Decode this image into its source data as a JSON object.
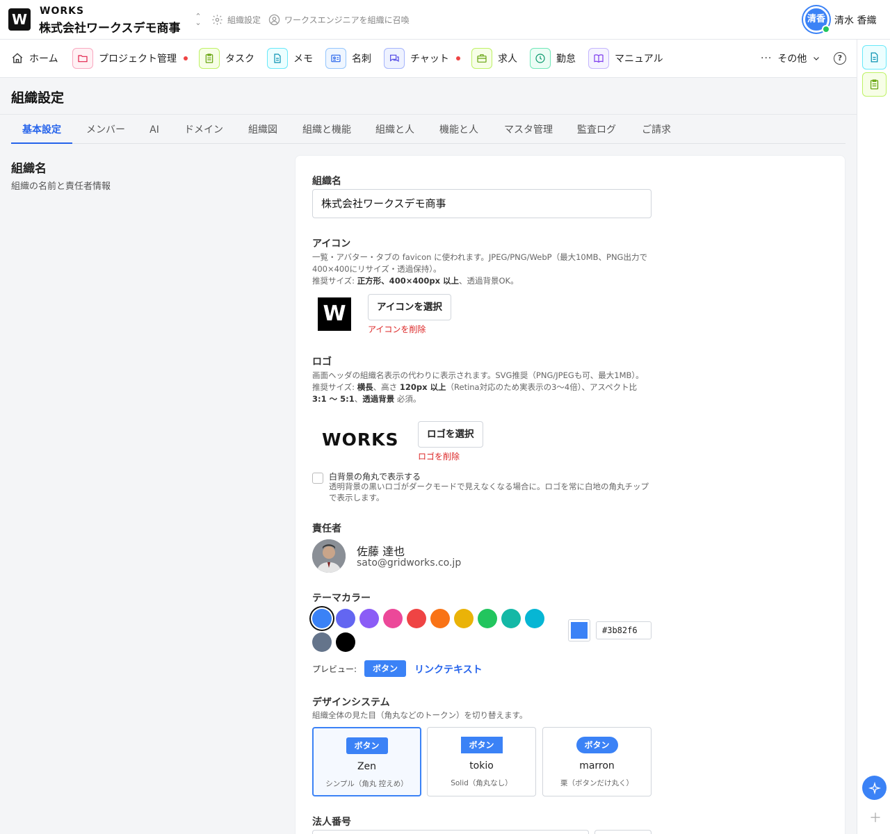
{
  "header": {
    "org_logo_letter": "W",
    "brand": "WORKS",
    "org_name": "株式会社ワークスデモ商事",
    "settings_link": "組織設定",
    "invite_link": "ワークスエンジニアを組織に召喚",
    "user_avatar": "清香",
    "user_name": "清水 香織"
  },
  "nav": {
    "items": [
      {
        "label": "ホーム",
        "icon": "home-icon"
      },
      {
        "label": "プロジェクト管理",
        "icon": "folder-icon",
        "color": "#e11d48",
        "dot": true
      },
      {
        "label": "タスク",
        "icon": "clipboard-icon",
        "color": "#65a30d"
      },
      {
        "label": "メモ",
        "icon": "document-icon",
        "color": "#0891b2"
      },
      {
        "label": "名刺",
        "icon": "card-icon",
        "color": "#2563eb"
      },
      {
        "label": "チャット",
        "icon": "chat-icon",
        "color": "#4f46e5",
        "dot": true
      },
      {
        "label": "求人",
        "icon": "briefcase-icon",
        "color": "#65a30d"
      },
      {
        "label": "勤怠",
        "icon": "clock-icon",
        "color": "#059669"
      },
      {
        "label": "マニュアル",
        "icon": "book-icon",
        "color": "#7c3aed"
      }
    ],
    "more_label": "その他"
  },
  "page": {
    "title": "組織設定",
    "tabs": [
      "基本設定",
      "メンバー",
      "AI",
      "ドメイン",
      "組織図",
      "組織と機能",
      "組織と人",
      "機能と人",
      "マスタ管理",
      "監査ログ",
      "ご請求"
    ],
    "active_tab": "基本設定"
  },
  "section": {
    "title": "組織名",
    "description": "組織の名前と責任者情報"
  },
  "form": {
    "org_name_label": "組織名",
    "org_name_value": "株式会社ワークスデモ商事",
    "icon_label": "アイコン",
    "icon_help_1": "一覧・アバター・タブの favicon に使われます。JPEG/PNG/WebP（最大10MB、PNG出力で400×400にリサイズ・透過保持）。",
    "icon_help_2_prefix": "推奨サイズ: ",
    "icon_help_2_bold": "正方形、400×400px 以上",
    "icon_help_2_suffix": "、透過背景OK。",
    "icon_preview_letter": "W",
    "icon_select_button": "アイコンを選択",
    "icon_delete_link": "アイコンを削除",
    "logo_label": "ロゴ",
    "logo_help_1": "画面ヘッダの組織名表示の代わりに表示されます。SVG推奨（PNG/JPEGも可、最大1MB）。",
    "logo_help_2a": "推奨サイズ: ",
    "logo_help_2b": "横長",
    "logo_help_2c": "、高さ ",
    "logo_help_2d": "120px 以上",
    "logo_help_2e": "（Retina対応のため実表示の3〜4倍）、アスペクト比 ",
    "logo_help_2f": "3:1 〜 5:1",
    "logo_help_2g": "、",
    "logo_help_2h": "透過背景",
    "logo_help_2i": " 必須。",
    "logo_preview_text": "WORKS",
    "logo_select_button": "ロゴを選択",
    "logo_delete_link": "ロゴを削除",
    "rounded_bg_label": "白背景の角丸で表示する",
    "rounded_bg_checked": false,
    "rounded_bg_help": "透明背景の黒いロゴがダークモードで見えなくなる場合に。ロゴを常に白地の角丸チップで表示します。",
    "owner_label": "責任者",
    "owner_name": "佐藤 達也",
    "owner_email": "sato@gridworks.co.jp",
    "theme_label": "テーマカラー",
    "theme_colors": [
      "#3b82f6",
      "#6366f1",
      "#8b5cf6",
      "#ec4899",
      "#ef4444",
      "#f97316",
      "#eab308",
      "#22c55e",
      "#14b8a6",
      "#06b6d4",
      "#64748b",
      "#000000"
    ],
    "theme_selected": "#3b82f6",
    "theme_hex_value": "#3b82f6",
    "preview_label": "プレビュー:",
    "preview_button": "ボタン",
    "preview_link": "リンクテキスト",
    "design_label": "デザインシステム",
    "design_help": "組織全体の見た目（角丸などのトークン）を切り替えます。",
    "design_options": [
      {
        "button": "ボタン",
        "name": "Zen",
        "desc": "シンプル（角丸 控えめ）",
        "selected": true
      },
      {
        "button": "ボタン",
        "name": "tokio",
        "desc": "Solid（角丸なし）",
        "selected": false
      },
      {
        "button": "ボタン",
        "name": "marron",
        "desc": "栗（ボタンだけ丸く）",
        "selected": false
      }
    ],
    "corp_number_label": "法人番号"
  }
}
